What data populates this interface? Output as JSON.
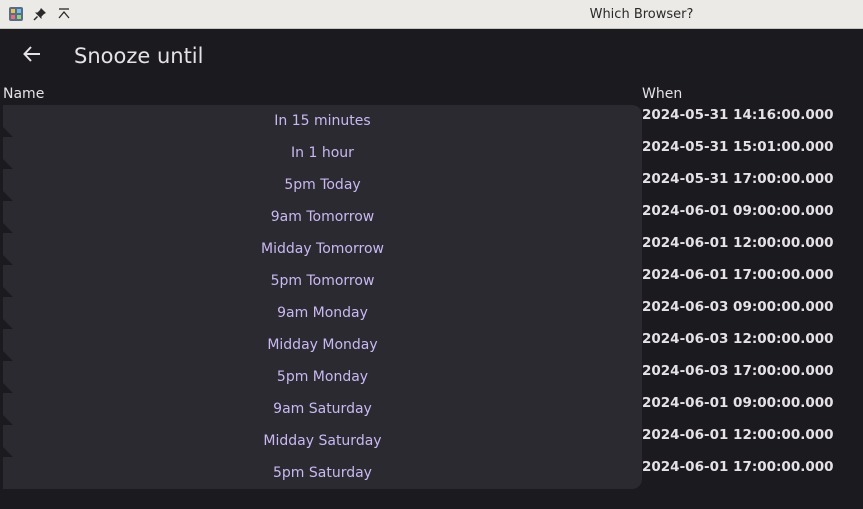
{
  "window": {
    "title": "Which Browser?"
  },
  "header": {
    "title": "Snooze until"
  },
  "columns": {
    "name": "Name",
    "when": "When"
  },
  "rows": [
    {
      "name": "In 15 minutes",
      "when": "2024-05-31 14:16:00.000"
    },
    {
      "name": "In 1 hour",
      "when": "2024-05-31 15:01:00.000"
    },
    {
      "name": "5pm Today",
      "when": "2024-05-31 17:00:00.000"
    },
    {
      "name": "9am Tomorrow",
      "when": "2024-06-01 09:00:00.000"
    },
    {
      "name": "Midday Tomorrow",
      "when": "2024-06-01 12:00:00.000"
    },
    {
      "name": "5pm Tomorrow",
      "when": "2024-06-01 17:00:00.000"
    },
    {
      "name": "9am Monday",
      "when": "2024-06-03 09:00:00.000"
    },
    {
      "name": "Midday Monday",
      "when": "2024-06-03 12:00:00.000"
    },
    {
      "name": "5pm Monday",
      "when": "2024-06-03 17:00:00.000"
    },
    {
      "name": "9am Saturday",
      "when": "2024-06-01 09:00:00.000"
    },
    {
      "name": "Midday Saturday",
      "when": "2024-06-01 12:00:00.000"
    },
    {
      "name": "5pm Saturday",
      "when": "2024-06-01 17:00:00.000"
    }
  ],
  "icons": {
    "app": "app-icon",
    "pin": "pin-icon",
    "keep_above": "keep-above-icon",
    "back": "back-arrow-icon"
  },
  "colors": {
    "background": "#1b1b1f",
    "list_background": "#2b2a30",
    "accent_text": "#c9b8f2",
    "primary_text": "#e6e1e6",
    "titlebar": "#eceae7"
  }
}
